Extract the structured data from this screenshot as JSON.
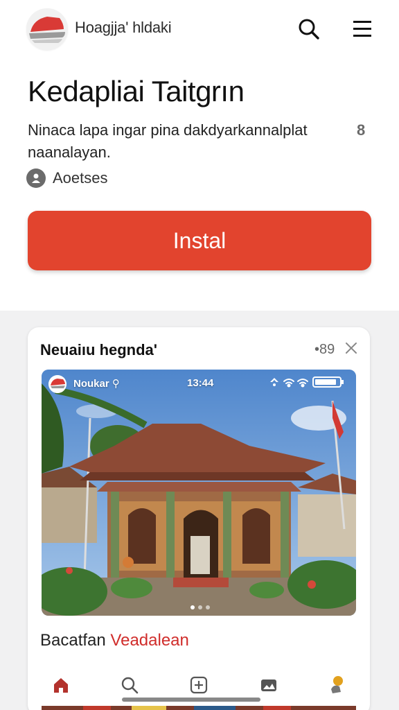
{
  "header": {
    "app_brand": "Hoagjja' hldaki",
    "logo_icon": "app-logo-icon",
    "search_icon": "search-icon",
    "menu_icon": "hamburger-menu-icon"
  },
  "app": {
    "title": "Kedapliai Taitgrın",
    "description": "Ninaca lapa ingar pina dakdyarkannalplat naanalayan.",
    "description_count": "8",
    "author": "Aoetses",
    "install_label": "Instal"
  },
  "card": {
    "title": "Neuaiıu hegnda'",
    "count": "•89",
    "screenshot": {
      "app_name": "Noukar ⚲",
      "time": "13:44",
      "page_dots": 3,
      "active_dot": 1
    },
    "caption_plain": "Bacatfan ",
    "caption_accent": "Veadalean"
  },
  "tabs": [
    {
      "name": "home-icon"
    },
    {
      "name": "search-icon"
    },
    {
      "name": "add-icon"
    },
    {
      "name": "gallery-icon"
    },
    {
      "name": "badge-icon"
    }
  ],
  "colors": {
    "accent": "#e2442e",
    "accent_text": "#d02d2b",
    "background_lower": "#f1f1f2"
  }
}
